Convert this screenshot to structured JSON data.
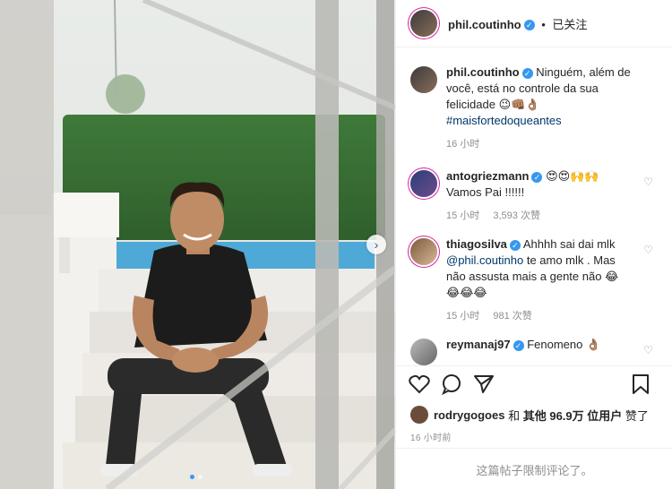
{
  "post": {
    "author": "phil.coutinho",
    "follow_status": "已关注",
    "separator": "•",
    "caption_user": "phil.coutinho",
    "caption_text": "Ninguém, além de você, está no controle da sua felicidade",
    "caption_emoji": "😉👊🏽👌🏽",
    "hashtag": "#maisfortedoqueantes",
    "caption_time": "16 小时",
    "carousel_pages": 2,
    "carousel_active": 1
  },
  "comments": [
    {
      "user": "antogriezmann",
      "text": "Vamos Pai !!!!!!",
      "emoji": "😍😍🙌🙌",
      "time": "15 小时",
      "likes": "3,593 次赞"
    },
    {
      "user": "thiagosilva",
      "text_1": "Ahhhh sai dai mlk",
      "mention": "@phil.coutinho",
      "text_2": "te amo mlk . Mas não assusta mais a gente não",
      "emoji_end": "😂",
      "emoji_line": "😂😂😂",
      "time": "15 小时",
      "likes": "981 次赞"
    },
    {
      "user": "reymanaj97",
      "text": "Fenomeno",
      "emoji": "👌🏽"
    }
  ],
  "likes": {
    "user": "rodrygogoes",
    "connector": "和",
    "others": "其他 96.9万 位用户",
    "suffix": "赞了"
  },
  "timestamp": "16 小时前",
  "comments_limited": "这篇帖子限制评论了。",
  "colors": {
    "accent": "#3897f0",
    "link": "#00376b",
    "muted": "#8e8e8e"
  }
}
